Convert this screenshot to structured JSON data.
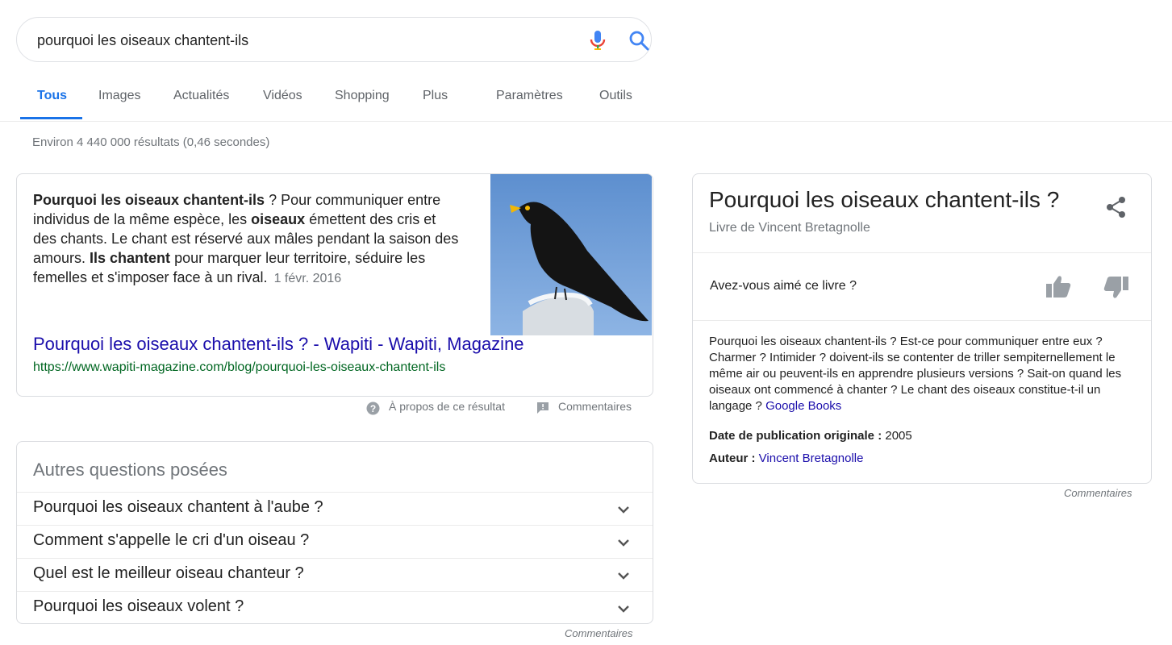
{
  "search": {
    "query": "pourquoi les oiseaux chantent-ils",
    "mic_icon": "microphone-icon",
    "search_icon": "magnifier-icon"
  },
  "tabs": [
    {
      "label": "Tous",
      "active": true
    },
    {
      "label": "Images"
    },
    {
      "label": "Actualités"
    },
    {
      "label": "Vidéos"
    },
    {
      "label": "Shopping"
    },
    {
      "label": "Plus"
    },
    {
      "label": "Paramètres"
    },
    {
      "label": "Outils"
    }
  ],
  "results_stats": "Environ 4 440 000 résultats (0,46 secondes)",
  "featured_snippet": {
    "text_bold_1": "Pourquoi les oiseaux chantent-ils",
    "text_1": " ? Pour communiquer entre individus de la même espèce, les ",
    "text_bold_2": "oiseaux",
    "text_2": " émettent des cris et des chants. Le chant est réservé aux mâles pendant la saison des amours. ",
    "text_bold_3": "Ils chantent",
    "text_3": " pour marquer leur territoire, séduire les femelles et s'imposer face à un rival.",
    "date": "1 févr. 2016",
    "image_alt": "blackbird singing",
    "link_title": "Pourquoi les oiseaux chantent-ils ? - Wapiti - Wapiti, Magazine",
    "url": "https://www.wapiti-magazine.com/blog/pourquoi-les-oiseaux-chantent-ils",
    "about_label": "À propos de ce résultat",
    "feedback_label": "Commentaires"
  },
  "people_also_ask": {
    "title": "Autres questions posées",
    "questions": [
      "Pourquoi les oiseaux chantent à l'aube ?",
      "Comment s'appelle le cri d'un oiseau ?",
      "Quel est le meilleur oiseau chanteur ?",
      "Pourquoi les oiseaux volent ?"
    ],
    "feedback_label": "Commentaires"
  },
  "knowledge_panel": {
    "title": "Pourquoi les oiseaux chantent-ils ?",
    "subtitle": "Livre de Vincent Bretagnolle",
    "rating_question": "Avez-vous aimé ce livre ?",
    "description": "Pourquoi les oiseaux chantent-ils ? Est-ce pour communiquer entre eux ? Charmer ? Intimider ? doivent-ils se contenter de triller sempiternellement le même air ou peuvent-ils en apprendre plusieurs versions ? Sait-on quand les oiseaux ont commencé à chanter ? Le chant des oiseaux constitue-t-il un langage ?",
    "source_link": "Google Books",
    "pub_label": "Date de publication originale :",
    "pub_value": "2005",
    "author_label": "Auteur :",
    "author_value": "Vincent Bretagnolle",
    "feedback_label": "Commentaires"
  },
  "colors": {
    "link": "#1a0dab",
    "url_green": "#006621",
    "tab_active": "#1a73e8",
    "muted": "#70757a"
  }
}
